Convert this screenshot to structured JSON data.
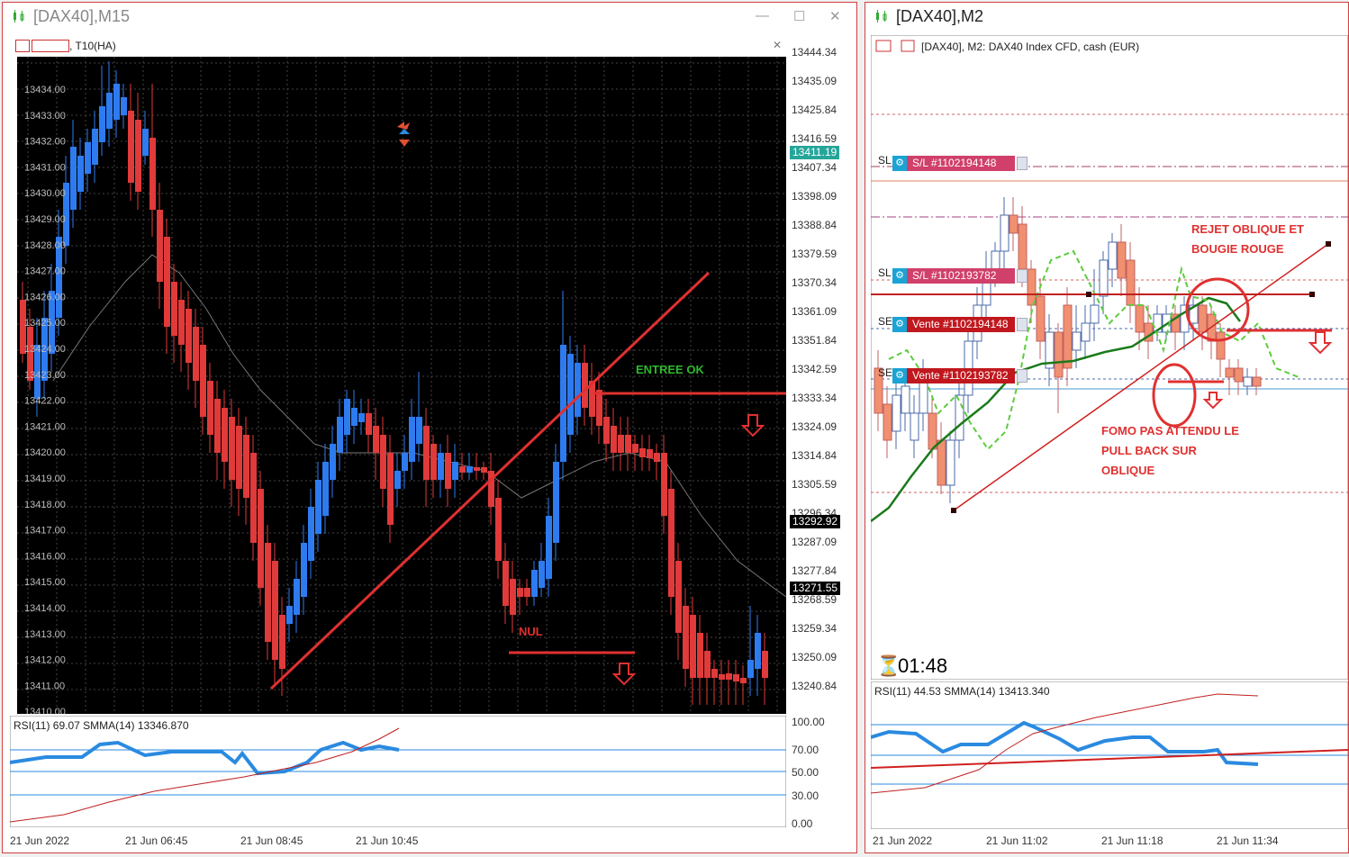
{
  "left_window": {
    "title": "[DAX40],M15",
    "subtab_title": ", T10(HA)",
    "indicator_info": "RSI(11) 69.07 SMMA(14) 13346.870",
    "price_axis": [
      "13444.34",
      "13435.09",
      "13425.84",
      "13416.59",
      "13407.34",
      "13398.09",
      "13388.84",
      "13379.59",
      "13370.34",
      "13361.09",
      "13351.84",
      "13342.59",
      "13333.34",
      "13324.09",
      "13314.84",
      "13305.59",
      "13296.34",
      "13287.09",
      "13277.84",
      "13268.59",
      "13259.34",
      "13250.09",
      "13240.84"
    ],
    "inner_scale": [
      "13434.00",
      "13433.00",
      "13432.00",
      "13431.00",
      "13430.00",
      "13429.00",
      "13428.00",
      "13427.00",
      "13426.00",
      "13425.00",
      "13424.00",
      "13423.00",
      "13422.00",
      "13421.00",
      "13420.00",
      "13419.00",
      "13418.00",
      "13417.00",
      "13416.00",
      "13415.00",
      "13414.00",
      "13413.00",
      "13412.00",
      "13411.00",
      "13410.00"
    ],
    "price_badges": [
      {
        "text": "13411.19",
        "color": "#26a69a"
      },
      {
        "text": "13292.92",
        "color": "#000000"
      },
      {
        "text": "13271.55",
        "color": "#000000"
      }
    ],
    "rsi_axis": [
      "100.00",
      "70.00",
      "50.00",
      "30.00",
      "0.00"
    ],
    "time_axis": [
      "21 Jun 2022",
      "21 Jun 06:45",
      "21 Jun 08:45",
      "21 Jun 10:45"
    ],
    "annotations": {
      "entry": "ENTREE OK",
      "null": "NUL"
    }
  },
  "right_window": {
    "title": "[DAX40],M2",
    "info": "[DAX40], M2:  DAX40 Index CFD, cash (EUR)",
    "timer": "01:48",
    "indicator_info": "RSI(11) 44.53 SMMA(14) 13413.340",
    "trades": [
      {
        "prefix": "SL",
        "label": "S/L #1102194148"
      },
      {
        "prefix": "SL",
        "label": "S/L #1102193782"
      },
      {
        "prefix": "SE",
        "label": "Vente #1102194148"
      },
      {
        "prefix": "SE",
        "label": "Vente #1102193782"
      }
    ],
    "annotations": {
      "reject": [
        "REJET OBLIQUE ET",
        "BOUGIE ROUGE"
      ],
      "fomo": [
        "FOMO PAS ATTENDU LE",
        "PULL BACK SUR",
        "OBLIQUE"
      ]
    },
    "time_axis": [
      "21 Jun 2022",
      "21 Jun 11:02",
      "21 Jun 11:18",
      "21 Jun 11:34"
    ]
  }
}
